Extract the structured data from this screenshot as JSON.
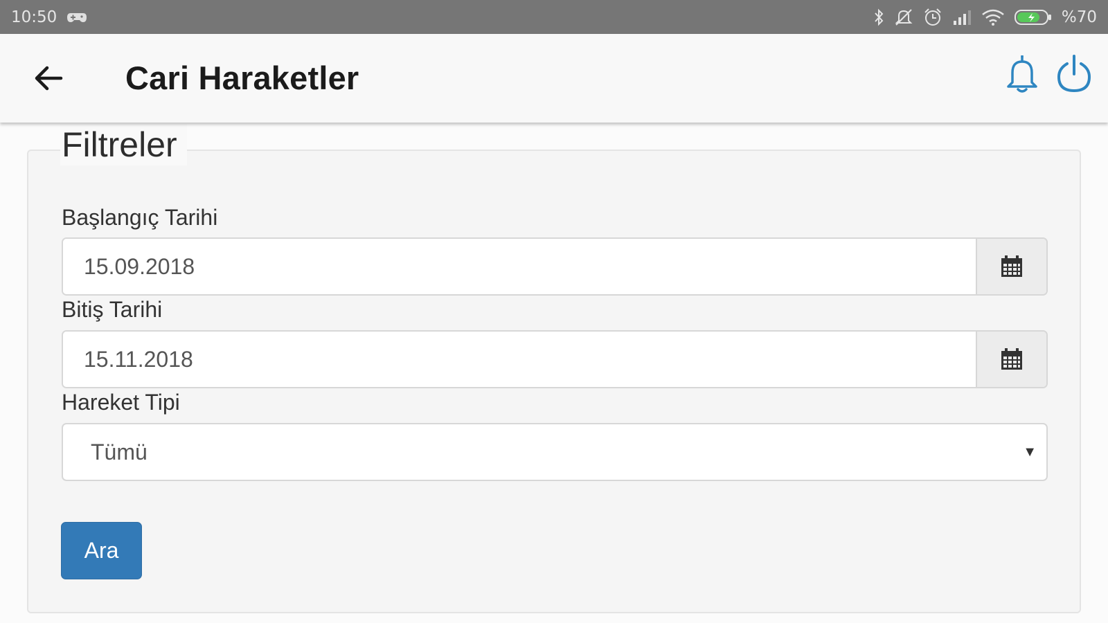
{
  "status_bar": {
    "time": "10:50",
    "battery": "%70",
    "icons": [
      "game-controller-icon",
      "bluetooth-icon",
      "mute-icon",
      "alarm-icon",
      "signal-icon",
      "wifi-icon",
      "battery-icon"
    ]
  },
  "header": {
    "title": "Cari Haraketler",
    "back_icon": "arrow-left-icon",
    "actions": [
      "bell-icon",
      "power-icon"
    ],
    "accent_color": "#2e86c1"
  },
  "filters": {
    "legend": "Filtreler",
    "start_date": {
      "label": "Başlangıç Tarihi",
      "value": "15.09.2018",
      "icon": "calendar-icon"
    },
    "end_date": {
      "label": "Bitiş Tarihi",
      "value": "15.11.2018",
      "icon": "calendar-icon"
    },
    "movement_type": {
      "label": "Hareket Tipi",
      "selected": "Tümü"
    },
    "search_button": "Ara",
    "button_color": "#337ab7"
  }
}
